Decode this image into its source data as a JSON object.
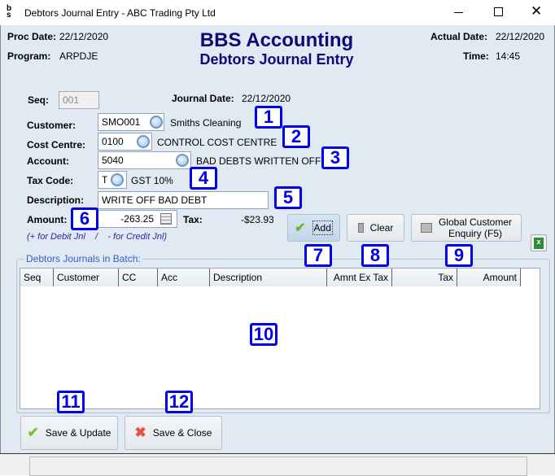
{
  "window": {
    "title": "Debtors Journal Entry - ABC Trading Pty Ltd",
    "minimize_icon": "minimize-icon",
    "maximize_icon": "maximize-icon",
    "close_icon": "close-icon"
  },
  "header": {
    "proc_date_label": "Proc Date:",
    "proc_date": "22/12/2020",
    "program_label": "Program:",
    "program": "ARPDJE",
    "app_title": "BBS Accounting",
    "form_title": "Debtors Journal Entry",
    "actual_date_label": "Actual Date:",
    "actual_date": "22/12/2020",
    "time_label": "Time:",
    "time": "14:45"
  },
  "form": {
    "seq_label": "Seq:",
    "seq": "001",
    "journal_date_label": "Journal Date:",
    "journal_date": "22/12/2020",
    "customer_label": "Customer:",
    "customer": "SMO001",
    "customer_name": "Smiths Cleaning",
    "cost_centre_label": "Cost Centre:",
    "cost_centre": "0100",
    "cost_centre_name": "CONTROL COST CENTRE",
    "account_label": "Account:",
    "account": "5040",
    "account_name": "BAD DEBTS WRITTEN OFF",
    "tax_code_label": "Tax Code:",
    "tax_code": "T",
    "tax_code_name": "GST 10%",
    "description_label": "Description:",
    "description": "WRITE OFF BAD DEBT",
    "amount_label": "Amount:",
    "amount": "-263.25",
    "tax_label": "Tax:",
    "tax": "-$23.93",
    "hint": "(+ for Debit Jnl    /    - for Credit Jnl)"
  },
  "buttons": {
    "add": "Add",
    "clear": "Clear",
    "global_enquiry_1": "Global Customer",
    "global_enquiry_2": "Enquiry (F5)",
    "save_update": "Save & Update",
    "save_close": "Save & Close"
  },
  "batch": {
    "title": "Debtors Journals in Batch:",
    "columns": [
      "Seq",
      "Customer",
      "CC",
      "Acc",
      "Description",
      "Amnt Ex Tax",
      "Tax",
      "Amount"
    ],
    "rows": []
  },
  "callouts": [
    "1",
    "2",
    "3",
    "4",
    "5",
    "6",
    "7",
    "8",
    "9",
    "10",
    "11",
    "12"
  ],
  "colors": {
    "title_blue": "#0a0a78",
    "callout": "#0000ee",
    "background": "#e1e9f3"
  }
}
